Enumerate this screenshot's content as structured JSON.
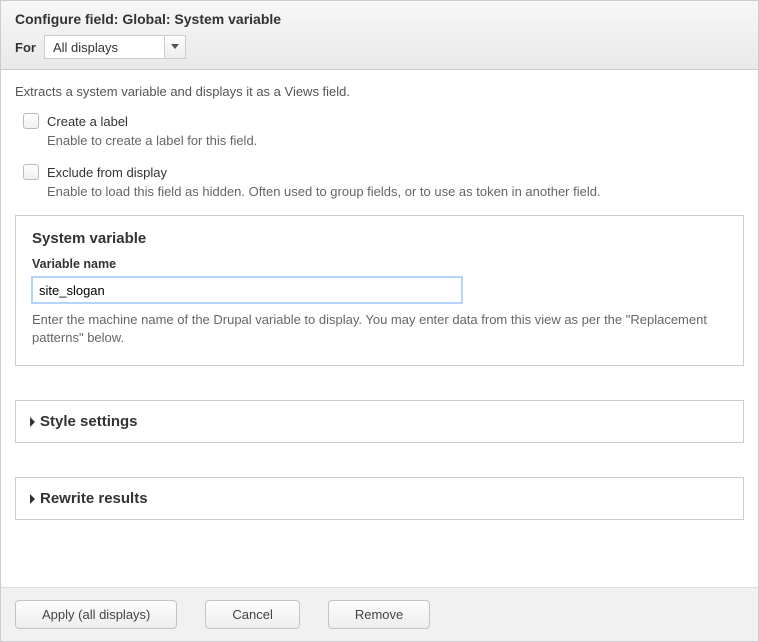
{
  "header": {
    "title": "Configure field: Global: System variable",
    "for_label": "For",
    "display_select": "All displays"
  },
  "main": {
    "description": "Extracts a system variable and displays it as a Views field.",
    "create_label": {
      "label": "Create a label",
      "help": "Enable to create a label for this field."
    },
    "exclude": {
      "label": "Exclude from display",
      "help": "Enable to load this field as hidden. Often used to group fields, or to use as token in another field."
    },
    "fieldset": {
      "legend": "System variable",
      "field_label": "Variable name",
      "value": "site_slogan",
      "help": "Enter the machine name of the Drupal variable to display. You may enter data from this view as per the \"Replacement patterns\" below."
    },
    "style_settings": "Style settings",
    "rewrite_results": "Rewrite results"
  },
  "footer": {
    "apply": "Apply (all displays)",
    "cancel": "Cancel",
    "remove": "Remove"
  }
}
